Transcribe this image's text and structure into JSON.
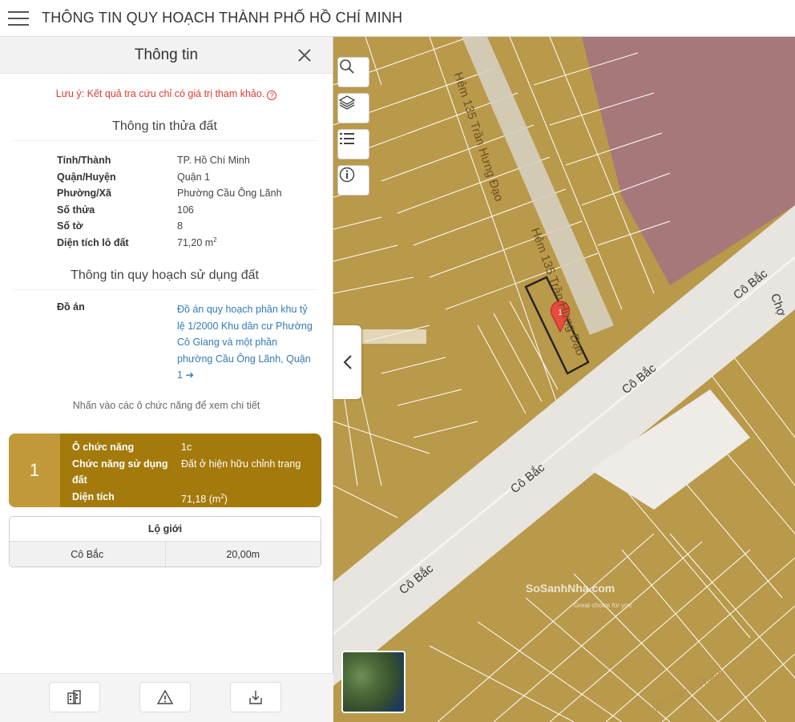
{
  "header": {
    "title": "THÔNG TIN QUY HOẠCH THÀNH PHỐ HỒ CHÍ MINH"
  },
  "panel": {
    "title": "Thông tin",
    "notice": "Lưu ý: Kết quả tra cứu chỉ có giá trị tham khảo.",
    "parcel_section": "Thông tin thửa đất",
    "parcel": [
      {
        "key": "Tỉnh/Thành",
        "value": "TP. Hồ Chí Minh"
      },
      {
        "key": "Quận/Huyện",
        "value": "Quận 1"
      },
      {
        "key": "Phường/Xã",
        "value": "Phường Cầu Ông Lãnh"
      },
      {
        "key": "Số thửa",
        "value": "106"
      },
      {
        "key": "Số tờ",
        "value": "8"
      },
      {
        "key": "Diện tích lô đất",
        "value": "71,20 m",
        "unit_sup": "2"
      }
    ],
    "plan_section": "Thông tin quy hoạch sử dụng đất",
    "doan_key": "Đồ án",
    "doan_link": "Đồ án quy hoạch phân khu tỷ lệ 1/2000 Khu dân cư Phường Cô Giang và một phần phường Cầu Ông Lãnh, Quận 1",
    "hint": "Nhấn vào các ô chức năng để xem chi tiết",
    "func": {
      "number": "1",
      "rows": [
        {
          "key": "Ô chức năng",
          "value": "1c"
        },
        {
          "key": "Chức năng sử dụng đất",
          "value": "Đất ở hiện hữu chỉnh trang"
        },
        {
          "key": "Diện tích",
          "value": "71,18 (m",
          "sup": "2",
          "tail": ")"
        }
      ]
    },
    "logioi": {
      "title": "Lộ giới",
      "street": "Cô Bắc",
      "width": "20,00m"
    }
  },
  "map": {
    "labels": {
      "hem1": "Hẻm 135 Trần Hưng Đạo",
      "hem2": "Hẻm 135 Trần Hưng Đạo",
      "cobac1": "Cô Bắc",
      "cobac2": "Cô Bắc",
      "cobac3": "Cô Bắc",
      "cobac4": "Cô Bắc",
      "cho": "Chợ",
      "hem3": "Hẻm Nhà Thám",
      "marker": "1"
    },
    "watermark": "SoSanhNha.com",
    "watermark_sub": "Great choice for you"
  },
  "colors": {
    "parcel": "#b9994a",
    "road": "#e8e4df",
    "commercial": "#a6787a",
    "func_card": "#a47a0c",
    "link": "#337ab7"
  }
}
